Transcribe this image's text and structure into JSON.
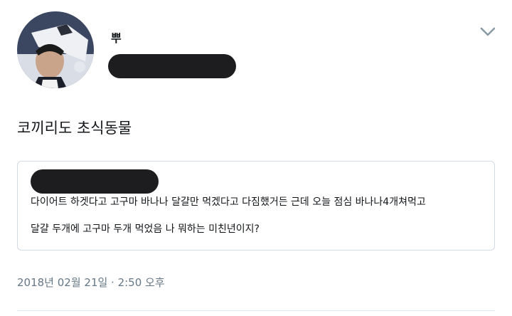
{
  "tweet": {
    "display_name": "뿌",
    "text": "코끼리도 초식동물",
    "timestamp": "2018년 02월 21일 · 2:50 오후"
  },
  "quoted_tweet": {
    "line1": "다이어트 하겟다고 고구마 바나나 달걀만 먹겠다고 다짐했거든 근데 오늘 점심 바나나4개쳐먹고",
    "line2": "달걀 두개에 고구마 두개 먹었음 나 뭐하는 미친년이지?"
  },
  "icons": {
    "menu": "chevron-down-icon",
    "avatar": "avatar-photo"
  },
  "colors": {
    "text": "#14171a",
    "meta": "#657786",
    "border": "#d2dbe3",
    "redaction": "#1d1d1f"
  }
}
